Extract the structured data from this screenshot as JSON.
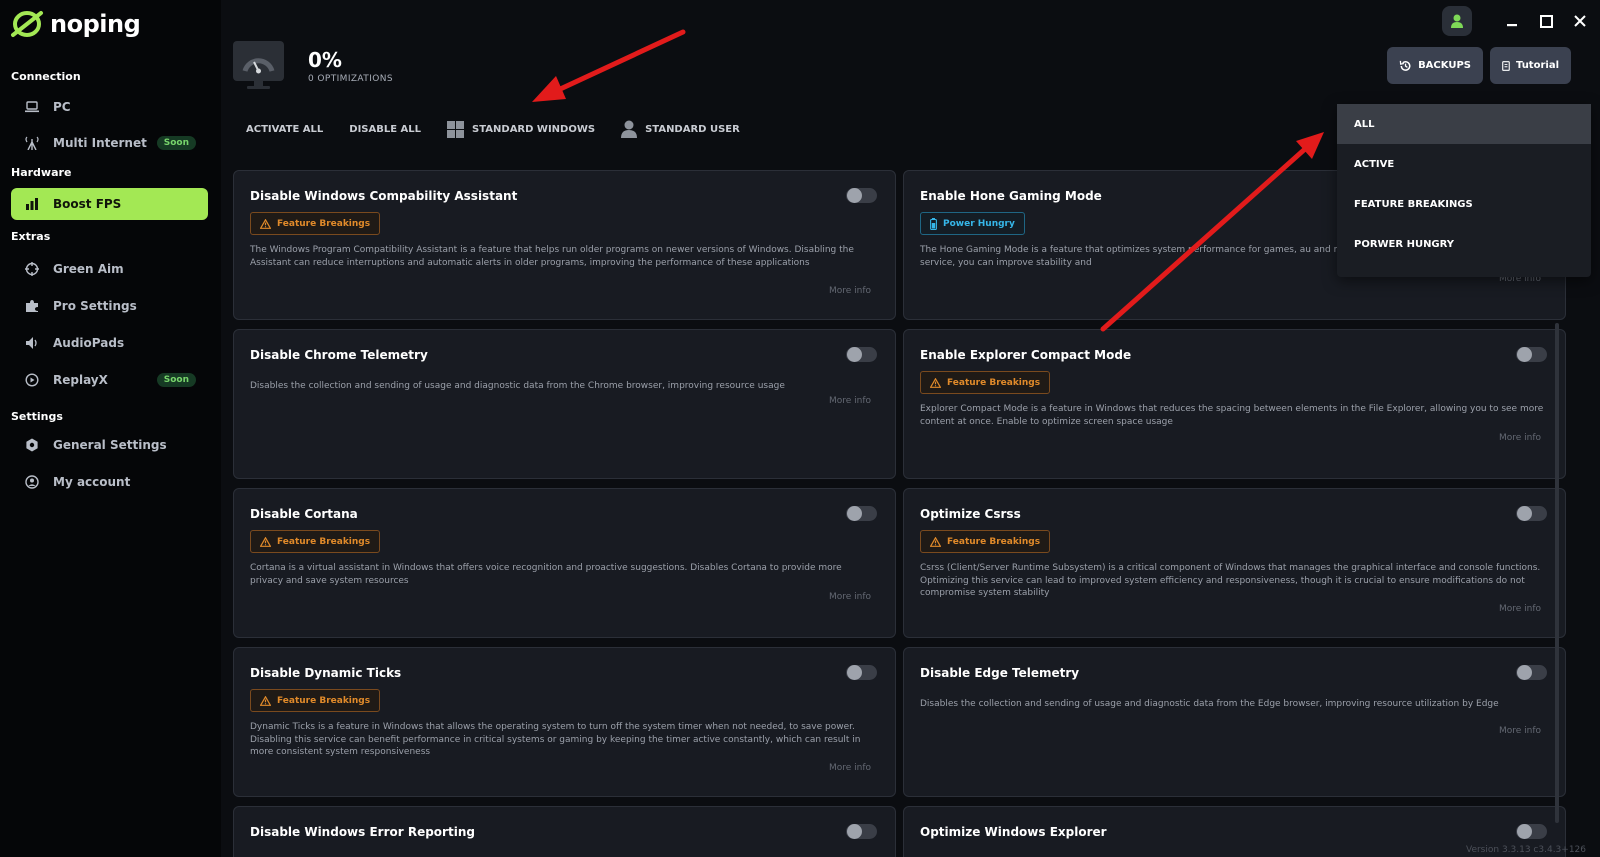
{
  "app": {
    "name": "noping"
  },
  "sidebar": {
    "sections": [
      {
        "title": "Connection"
      },
      {
        "title": "Hardware"
      },
      {
        "title": "Extras"
      },
      {
        "title": "Settings"
      }
    ],
    "items": [
      {
        "label": "PC",
        "icon": "laptop-icon"
      },
      {
        "label": "Multi Internet",
        "icon": "antenna-icon",
        "badge": "Soon"
      },
      {
        "label": "Boost FPS",
        "icon": "bar-chart-icon",
        "active": true
      },
      {
        "label": "Green Aim",
        "icon": "crosshair-icon"
      },
      {
        "label": "Pro Settings",
        "icon": "puzzle-icon"
      },
      {
        "label": "AudioPads",
        "icon": "speaker-icon"
      },
      {
        "label": "ReplayX",
        "icon": "replay-icon",
        "badge": "Soon"
      },
      {
        "label": "General Settings",
        "icon": "gear-icon"
      },
      {
        "label": "My account",
        "icon": "user-circle-icon"
      }
    ]
  },
  "header": {
    "percent": "0%",
    "optimizations": "0 OPTIMIZATIONS",
    "backups_label": "BACKUPS",
    "tutorial_label": "Tutorial"
  },
  "filters": {
    "activate_all": "ACTIVATE ALL",
    "disable_all": "DISABLE ALL",
    "standard_windows": "STANDARD WINDOWS",
    "standard_user": "STANDARD USER"
  },
  "dropdown": {
    "options": [
      "ALL",
      "ACTIVE",
      "FEATURE BREAKINGS",
      "PORWER HUNGRY"
    ],
    "selected": "ALL"
  },
  "cards": [
    {
      "title": "Disable Windows Compability Assistant",
      "badge": "Feature Breakings",
      "badge_type": "warn",
      "description": "The Windows Program Compatibility Assistant is a feature that helps run older programs on newer versions of Windows. Disabling the Assistant can reduce interruptions and automatic alerts in older programs, improving the performance of these applications",
      "more": "More info",
      "enabled": false
    },
    {
      "title": "Enable Hone Gaming Mode",
      "badge": "Power Hungry",
      "badge_type": "power",
      "description": "The Hone Gaming Mode is a feature that optimizes system performance for games, au and minimizing interruptions. By enabling this service, you can improve stability and",
      "more": "More info",
      "enabled": false
    },
    {
      "title": "Disable Chrome Telemetry",
      "badge": "",
      "badge_type": "",
      "description": "Disables the collection and sending of usage and diagnostic data from the Chrome browser, improving resource usage",
      "more": "More info",
      "enabled": false
    },
    {
      "title": "Enable Explorer Compact Mode",
      "badge": "Feature Breakings",
      "badge_type": "warn",
      "description": "Explorer Compact Mode is a feature in Windows that reduces the spacing between elements in the File Explorer, allowing you to see more content at once. Enable to optimize screen space usage",
      "more": "More info",
      "enabled": false
    },
    {
      "title": "Disable Cortana",
      "badge": "Feature Breakings",
      "badge_type": "warn",
      "description": "Cortana is a virtual assistant in Windows that offers voice recognition and proactive suggestions. Disables Cortana to provide more privacy and save system resources",
      "more": "More info",
      "enabled": false
    },
    {
      "title": "Optimize Csrss",
      "badge": "Feature Breakings",
      "badge_type": "warn",
      "description": "Csrss (Client/Server Runtime Subsystem) is a critical component of Windows that manages the graphical interface and console functions. Optimizing this service can lead to improved system efficiency and responsiveness, though it is crucial to ensure modifications do not compromise system stability",
      "more": "More info",
      "enabled": false
    },
    {
      "title": "Disable Dynamic Ticks",
      "badge": "Feature Breakings",
      "badge_type": "warn",
      "description": "Dynamic Ticks is a feature in Windows that allows the operating system to turn off the system timer when not needed, to save power. Disabling this service can benefit performance in critical systems or gaming by keeping the timer active constantly, which can result in more consistent system responsiveness",
      "more": "More info",
      "enabled": false
    },
    {
      "title": "Disable Edge Telemetry",
      "badge": "",
      "badge_type": "",
      "description": "Disables the collection and sending of usage and diagnostic data from the Edge browser, improving resource utilization by Edge",
      "more": "More info",
      "enabled": false
    },
    {
      "title": "Disable Windows Error Reporting",
      "badge": "",
      "badge_type": "",
      "description": "",
      "more": "",
      "enabled": false
    },
    {
      "title": "Optimize Windows Explorer",
      "badge": "",
      "badge_type": "",
      "description": "",
      "more": "",
      "enabled": false
    }
  ],
  "version": "Version 3.3.13 c3.4.3+126",
  "colors": {
    "accent": "#a3e854",
    "warn": "#e08a2a",
    "power": "#36b6e8",
    "arrow": "#e21b1b"
  }
}
